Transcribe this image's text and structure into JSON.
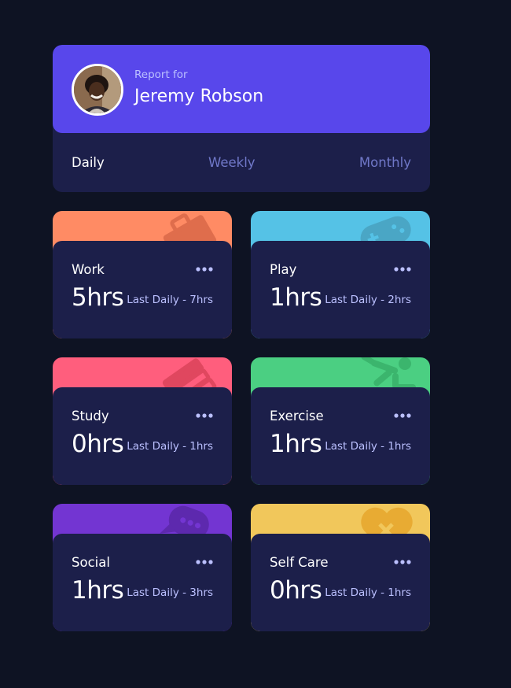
{
  "profile": {
    "report_label": "Report for",
    "name": "Jeremy Robson",
    "avatar_icon": "user-avatar"
  },
  "tabs": [
    {
      "label": "Daily",
      "active": true
    },
    {
      "label": "Weekly",
      "active": false
    },
    {
      "label": "Monthly",
      "active": false
    }
  ],
  "activities": [
    {
      "title": "Work",
      "hours": "5hrs",
      "previous": "Last Daily - 7hrs",
      "color": "#ff8b64",
      "icon": "briefcase-icon"
    },
    {
      "title": "Play",
      "hours": "1hrs",
      "previous": "Last Daily - 2hrs",
      "color": "#55c2e6",
      "icon": "gamepad-icon"
    },
    {
      "title": "Study",
      "hours": "0hrs",
      "previous": "Last Daily - 1hrs",
      "color": "#ff5e7d",
      "icon": "books-icon"
    },
    {
      "title": "Exercise",
      "hours": "1hrs",
      "previous": "Last Daily - 1hrs",
      "color": "#4bcf82",
      "icon": "running-person-icon"
    },
    {
      "title": "Social",
      "hours": "1hrs",
      "previous": "Last Daily - 3hrs",
      "color": "#7335d2",
      "icon": "chat-bubble-icon"
    },
    {
      "title": "Self Care",
      "hours": "0hrs",
      "previous": "Last Daily - 1hrs",
      "color": "#f1c75b",
      "icon": "heart-icon"
    }
  ]
}
